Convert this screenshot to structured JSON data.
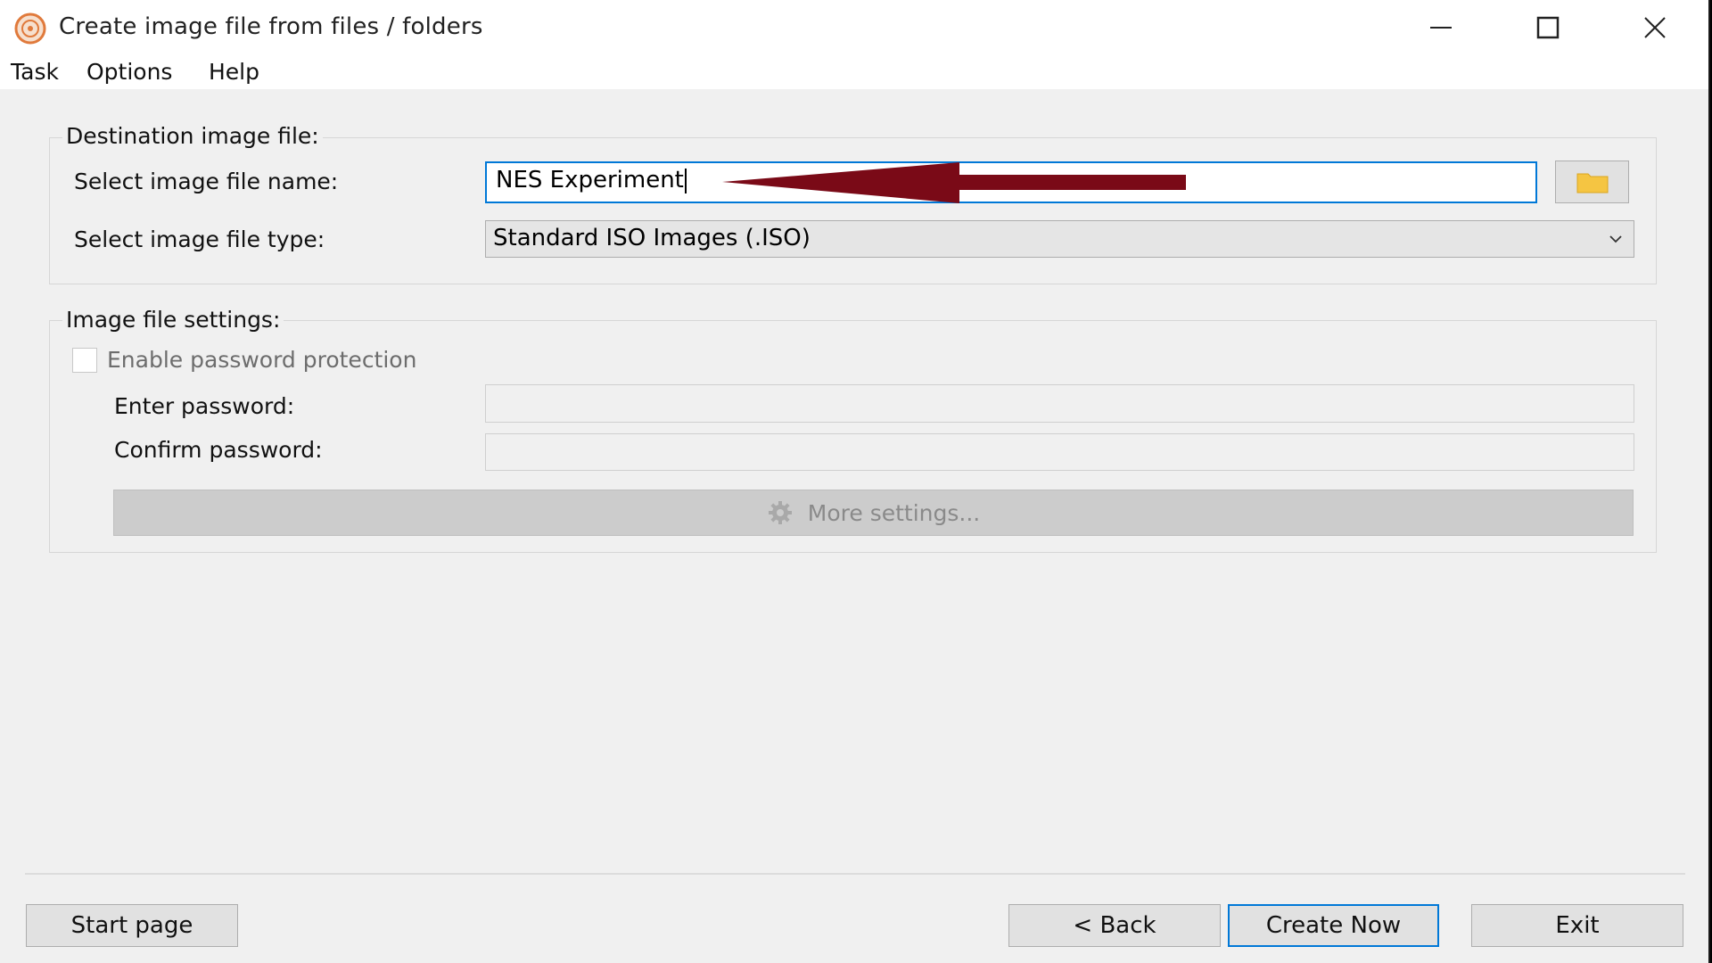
{
  "window": {
    "title": "Create image file from files / folders"
  },
  "menu": [
    "Task",
    "Options",
    "Help"
  ],
  "destination": {
    "group_title": "Destination image file:",
    "name_label": "Select image file name:",
    "name_value": "NES Experiment",
    "type_label": "Select image file type:",
    "type_value": "Standard ISO Images (.ISO)"
  },
  "settings": {
    "group_title": "Image file settings:",
    "enable_password_label": "Enable password protection",
    "enable_password_checked": false,
    "enter_password_label": "Enter password:",
    "confirm_password_label": "Confirm password:",
    "more_settings_label": "More settings..."
  },
  "footer": {
    "start_page": "Start page",
    "back": "< Back",
    "create_now": "Create Now",
    "exit": "Exit"
  },
  "colors": {
    "accent": "#0078d7",
    "annotation_arrow": "#7a0a17",
    "folder_icon": "#f5c542"
  },
  "icons": {
    "app": "disc-icon",
    "browse": "folder-icon",
    "more_settings": "gear-icon"
  }
}
